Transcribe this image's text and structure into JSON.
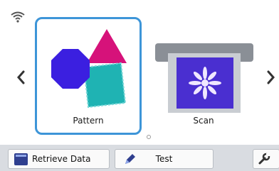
{
  "carousel": {
    "items": [
      {
        "label": "Pattern",
        "icon": "shapes-icon",
        "selected": true
      },
      {
        "label": "Scan",
        "icon": "scanner-icon",
        "selected": false
      }
    ]
  },
  "bottom_bar": {
    "retrieve_label": "Retrieve Data",
    "test_label": "Test",
    "settings_icon": "wrench-icon"
  },
  "colors": {
    "selection_border": "#3d95d8",
    "octagon": "#3b1fe0",
    "triangle": "#d6127a",
    "square": "#1fb3b3",
    "bottom_bar": "#d9dce1"
  }
}
